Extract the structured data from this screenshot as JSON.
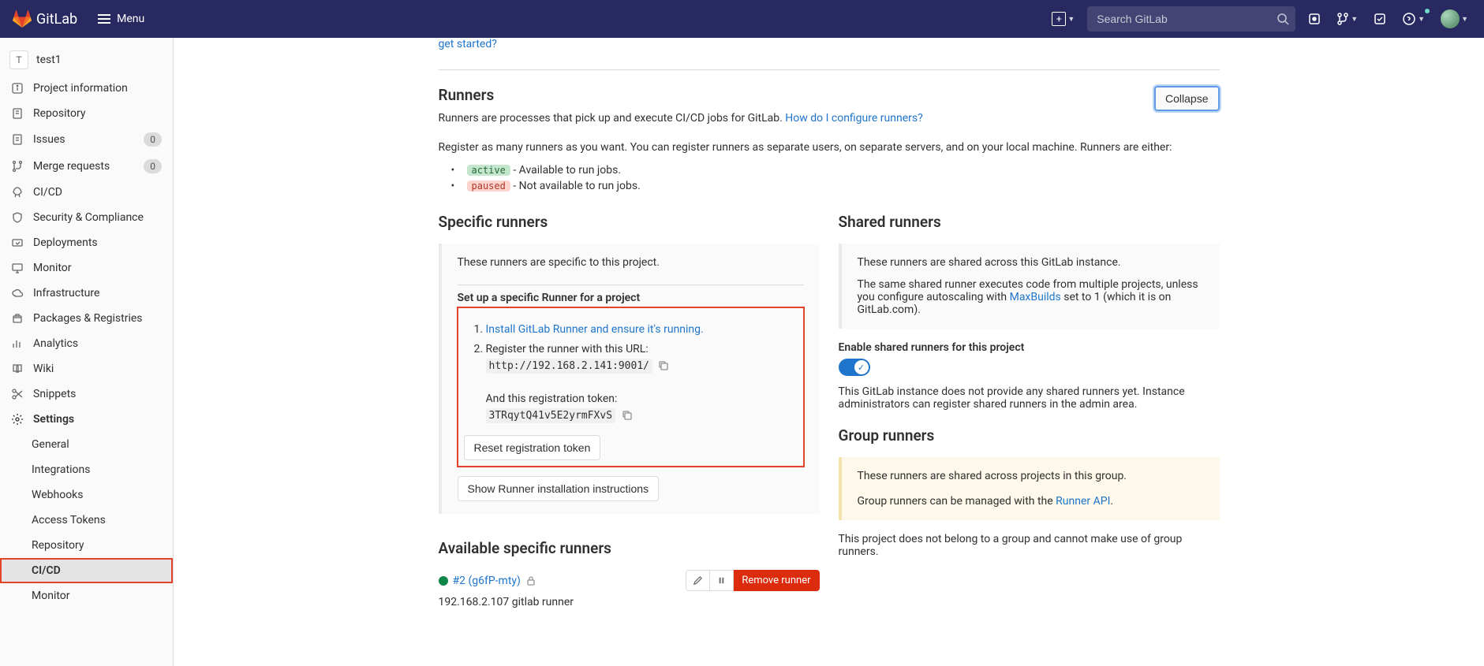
{
  "topbar": {
    "brand": "GitLab",
    "menu": "Menu",
    "search_placeholder": "Search GitLab"
  },
  "sidebar": {
    "project_initial": "T",
    "project_name": "test1",
    "items": [
      {
        "label": "Project information"
      },
      {
        "label": "Repository"
      },
      {
        "label": "Issues",
        "badge": "0"
      },
      {
        "label": "Merge requests",
        "badge": "0"
      },
      {
        "label": "CI/CD"
      },
      {
        "label": "Security & Compliance"
      },
      {
        "label": "Deployments"
      },
      {
        "label": "Monitor"
      },
      {
        "label": "Infrastructure"
      },
      {
        "label": "Packages & Registries"
      },
      {
        "label": "Analytics"
      },
      {
        "label": "Wiki"
      },
      {
        "label": "Snippets"
      },
      {
        "label": "Settings"
      }
    ],
    "sub": {
      "general": "General",
      "integrations": "Integrations",
      "webhooks": "Webhooks",
      "access_tokens": "Access Tokens",
      "repository": "Repository",
      "cicd": "CI/CD",
      "monitor": "Monitor"
    }
  },
  "cut_link": "get started?",
  "runners": {
    "heading": "Runners",
    "collapse": "Collapse",
    "desc1": "Runners are processes that pick up and execute CI/CD jobs for GitLab. ",
    "desc1_link": "How do I configure runners?",
    "desc2": "Register as many runners as you want. You can register runners as separate users, on separate servers, and on your local machine. Runners are either:",
    "active_label": "active",
    "active_text": " - Available to run jobs.",
    "paused_label": "paused",
    "paused_text": " - Not available to run jobs."
  },
  "specific": {
    "heading": "Specific runners",
    "intro": "These runners are specific to this project.",
    "setup_title": "Set up a specific Runner for a project",
    "step1_link": "Install GitLab Runner and ensure it's running.",
    "step2": "Register the runner with this URL:",
    "url": "http://192.168.2.141:9001/",
    "token_label": "And this registration token:",
    "token": "3TRqytQ41v5E2yrmFXvS",
    "reset_btn": "Reset registration token",
    "show_btn": "Show Runner installation instructions"
  },
  "shared": {
    "heading": "Shared runners",
    "intro": "These runners are shared across this GitLab instance.",
    "note1": "The same shared runner executes code from multiple projects, unless you configure autoscaling with ",
    "note1_link": "MaxBuilds",
    "note1_end": " set to 1 (which it is on GitLab.com).",
    "enable_label": "Enable shared runners for this project",
    "instance_note": "This GitLab instance does not provide any shared runners yet. Instance administrators can register shared runners in the admin area."
  },
  "group": {
    "heading": "Group runners",
    "line1": "These runners are shared across projects in this group.",
    "line2a": "Group runners can be managed with the ",
    "line2_link": "Runner API",
    "line2b": ".",
    "below": "This project does not belong to a group and cannot make use of group runners."
  },
  "available": {
    "heading": "Available specific runners",
    "runner_label": "#2 (g6fP-mty)",
    "remove": "Remove runner",
    "desc": "192.168.2.107 gitlab runner"
  }
}
